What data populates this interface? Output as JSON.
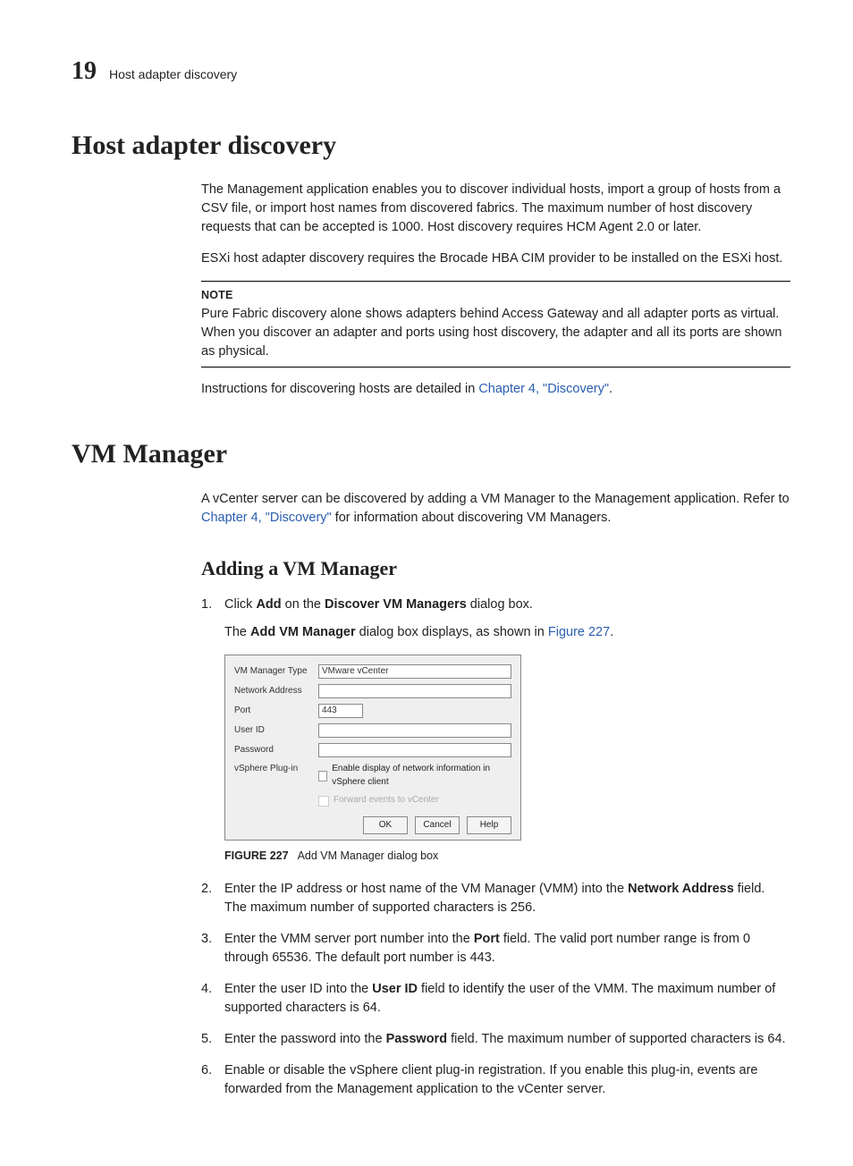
{
  "header": {
    "chapter_number": "19",
    "chapter_title": "Host adapter discovery"
  },
  "section1": {
    "title": "Host adapter discovery",
    "p1": "The Management application enables you to discover individual hosts, import a group of hosts from a CSV file, or import host names from discovered fabrics. The maximum number of host discovery requests that can be accepted is 1000. Host discovery requires HCM Agent 2.0 or later.",
    "p2": "ESXi host adapter discovery requires the Brocade HBA CIM provider to be installed on the ESXi host.",
    "note_label": "NOTE",
    "note_text": "Pure Fabric discovery alone shows adapters behind Access Gateway and all adapter ports as virtual. When you discover an adapter and ports using host discovery, the adapter and all its ports are shown as physical.",
    "p3_a": "Instructions for discovering hosts are detailed in ",
    "p3_link": "Chapter 4, \"Discovery\"",
    "p3_b": "."
  },
  "section2": {
    "title": "VM Manager",
    "intro_a": "A vCenter server can be discovered by adding a VM Manager to the Management application. Refer to ",
    "intro_link": "Chapter 4, \"Discovery\"",
    "intro_b": " for information about discovering VM Managers.",
    "sub_title": "Adding a VM Manager",
    "step1_a": "Click ",
    "step1_b": "Add",
    "step1_c": " on the ",
    "step1_d": "Discover VM Managers",
    "step1_e": " dialog box.",
    "step1_sub_a": "The ",
    "step1_sub_b": "Add VM Manager",
    "step1_sub_c": " dialog box displays, as shown in ",
    "step1_sub_link": "Figure 227",
    "step1_sub_d": ".",
    "step2_a": "Enter the IP address or host name of the VM Manager (VMM) into the ",
    "step2_b": "Network Address",
    "step2_c": " field. The maximum number of supported characters is 256.",
    "step3_a": "Enter the VMM server port number into the ",
    "step3_b": "Port",
    "step3_c": " field. The valid port number range is from 0 through 65536. The default port number is 443.",
    "step4_a": "Enter the user ID into the ",
    "step4_b": "User ID",
    "step4_c": " field to identify the user of the VMM. The maximum number of supported characters is 64.",
    "step5_a": "Enter the password into the ",
    "step5_b": "Password",
    "step5_c": " field. The maximum number of supported characters is 64.",
    "step6": "Enable or disable the vSphere client plug-in registration. If you enable this plug-in, events are forwarded from the Management application to the vCenter server."
  },
  "dialog": {
    "labels": {
      "type": "VM Manager Type",
      "addr": "Network Address",
      "port": "Port",
      "user": "User ID",
      "pass": "Password",
      "plugin": "vSphere Plug-in"
    },
    "values": {
      "type": "VMware vCenter",
      "port": "443"
    },
    "chk1": "Enable display of network information in vSphere client",
    "chk2": "Forward events to vCenter",
    "buttons": {
      "ok": "OK",
      "cancel": "Cancel",
      "help": "Help"
    }
  },
  "figure": {
    "label": "FIGURE 227",
    "caption": "Add VM Manager dialog box"
  }
}
